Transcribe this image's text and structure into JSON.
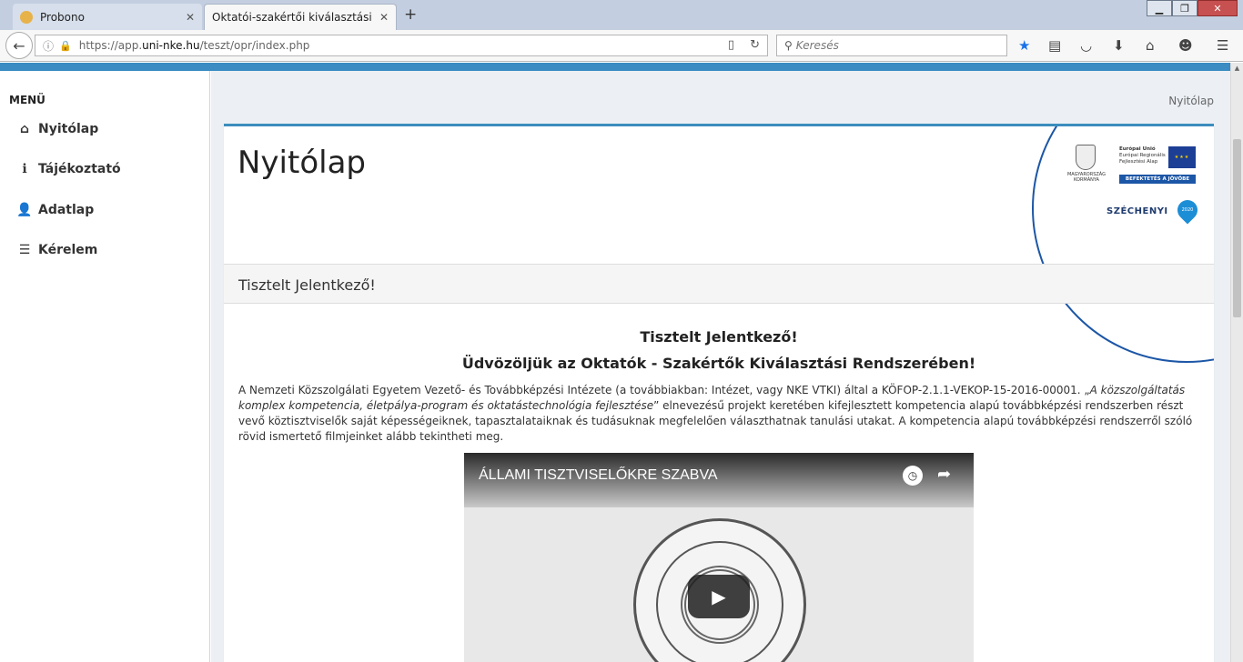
{
  "browser": {
    "tabs": [
      {
        "title": "Probono",
        "active": false
      },
      {
        "title": "Oktatói-szakértői kiválasztási re...",
        "active": true
      }
    ],
    "url": {
      "scheme": "https://app.",
      "domain": "uni-nke.hu",
      "path": "/teszt/opr/index.php"
    },
    "search_placeholder": "Keresés"
  },
  "sidebar": {
    "header": "MENÜ",
    "items": [
      {
        "label": "Nyitólap",
        "icon": "home-icon"
      },
      {
        "label": "Tájékoztató",
        "icon": "info-icon"
      },
      {
        "label": "Adatlap",
        "icon": "user-icon"
      },
      {
        "label": "Kérelem",
        "icon": "list-icon"
      }
    ]
  },
  "breadcrumb": "Nyitólap",
  "page": {
    "title": "Nyitólap",
    "logo": {
      "gov": "MAGYARORSZÁG KORMÁNYA",
      "eu_lines": [
        "Európai Unió",
        "Európai Regionális",
        "Fejlesztési Alap"
      ],
      "eu_banner": "BEFEKTETÉS A JÖVŐBE",
      "szechenyi": "SZÉCHENYI",
      "year": "2020"
    },
    "box_header": "Tisztelt Jelentkező!",
    "welcome_line1": "Tisztelt Jelentkező!",
    "welcome_line2": "Üdvözöljük az Oktatók - Szakértők Kiválasztási Rendszerében!",
    "paragraph_start": "A Nemzeti Közszolgálati Egyetem Vezető- és Továbbképzési Intézete (a továbbiakban: Intézet, vagy NKE VTKI) által a KÖFOP-2.1.1-VEKOP-15-2016-00001. „",
    "paragraph_italic": "A közszolgáltatás komplex kompetencia, életpálya-program és oktatástechnológia fejlesztése",
    "paragraph_end": "” elnevezésű projekt keretében kifejlesztett kompetencia alapú továbbképzési rendszerben részt vevő köztisztviselők saját képességeiknek, tapasztalataiknak és tudásuknak megfelelően választhatnak tanulási utakat. A kompetencia alapú továbbképzési rendszerről szóló rövid ismertető filmjeinket alább tekintheti meg.",
    "video_title": "ÁLLAMI TISZTVISELŐKRE SZABVA"
  },
  "colors": {
    "accent": "#3c8dbc",
    "eu_blue": "#1c56a6"
  }
}
